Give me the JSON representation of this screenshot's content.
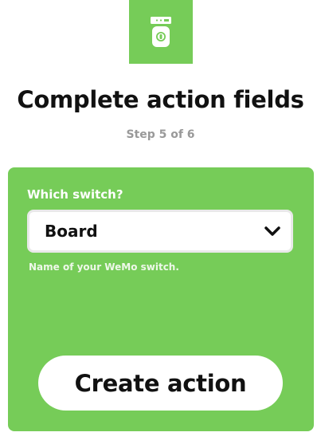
{
  "service": {
    "icon": "wemo-switch-icon",
    "brand_color": "#76cc58"
  },
  "header": {
    "title": "Complete action fields",
    "step": "Step 5 of 6"
  },
  "form": {
    "field_label": "Which switch?",
    "selected_value": "Board",
    "dropdown_icon": "chevron-down-icon",
    "help_text": "Name of your WeMo switch."
  },
  "actions": {
    "create_label": "Create action"
  }
}
